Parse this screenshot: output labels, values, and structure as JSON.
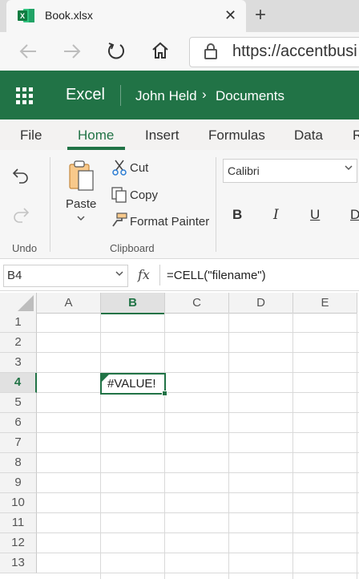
{
  "browser": {
    "tab_title": "Book.xlsx",
    "tab_close": "✕",
    "new_tab": "+",
    "url": "https://accentbusi"
  },
  "excel": {
    "app_name": "Excel",
    "breadcrumb": {
      "user": "John Held",
      "separator": "›",
      "folder": "Documents"
    },
    "accent_color": "#217346"
  },
  "menu": {
    "tabs": [
      "File",
      "Home",
      "Insert",
      "Formulas",
      "Data",
      "R"
    ],
    "active": "Home"
  },
  "ribbon": {
    "undo_group": "Undo",
    "clipboard_group": "Clipboard",
    "paste": "Paste",
    "cut": "Cut",
    "copy": "Copy",
    "format_painter": "Format Painter",
    "font_name": "Calibri",
    "bold": "B",
    "italic": "I",
    "underline": "U",
    "strikethrough": "D"
  },
  "formula_bar": {
    "name_box": "B4",
    "fx": "fx",
    "formula": "=CELL(\"filename\")"
  },
  "grid": {
    "columns": [
      "A",
      "B",
      "C",
      "D",
      "E"
    ],
    "rows": [
      "1",
      "2",
      "3",
      "4",
      "5",
      "6",
      "7",
      "8",
      "9",
      "10",
      "11",
      "12",
      "13"
    ],
    "selected_column": "B",
    "selected_row": "4",
    "active_cell_value": "#VALUE!"
  }
}
